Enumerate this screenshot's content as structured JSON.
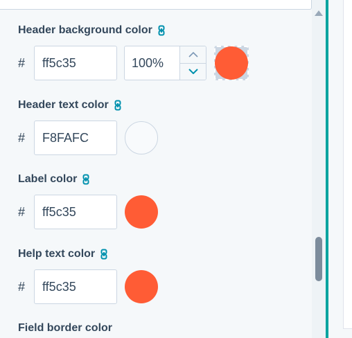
{
  "colors": {
    "accent": "#ff5c35",
    "header_text": "#F8FAFC",
    "panel_accent_line": "#00a4a0",
    "label_text": "#33475b"
  },
  "settings": [
    {
      "id": "header-background",
      "label": "Header background color",
      "icon": "link-icon",
      "hash": "#",
      "hex_value": "ff5c35",
      "opacity": "100%",
      "swatch_color": "#ff5c35"
    },
    {
      "id": "header-text",
      "label": "Header text color",
      "icon": "link-icon",
      "hash": "#",
      "hex_value": "F8FAFC",
      "swatch_color": "#F8FAFC"
    },
    {
      "id": "label",
      "label": "Label color",
      "icon": "link-icon",
      "hash": "#",
      "hex_value": "ff5c35",
      "swatch_color": "#ff5c35"
    },
    {
      "id": "help-text",
      "label": "Help text color",
      "icon": "link-icon",
      "hash": "#",
      "hex_value": "ff5c35",
      "swatch_color": "#ff5c35"
    },
    {
      "id": "field-border",
      "label": "Field border color"
    }
  ],
  "scrollbar": {
    "up_icon": "triangle-up-icon"
  }
}
